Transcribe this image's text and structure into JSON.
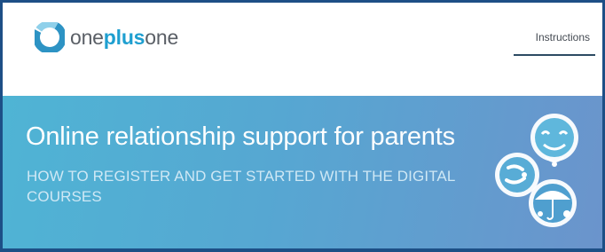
{
  "header": {
    "logo": {
      "text_part1": "one",
      "text_part2": "plus",
      "text_part3": "one",
      "icon": "oneplusone-logo-icon"
    },
    "nav": {
      "instructions_label": "Instructions"
    }
  },
  "hero": {
    "title": "Online relationship support for parents",
    "subtitle": "HOW TO REGISTER AND GET STARTED WITH THE DIGITAL COURSES",
    "illustration": "family-characters-icon"
  },
  "colors": {
    "brand_blue": "#1e9fd0",
    "hero_start": "#4fb4d4",
    "hero_end": "#6b94cc",
    "frame_border": "#1d4f86"
  }
}
